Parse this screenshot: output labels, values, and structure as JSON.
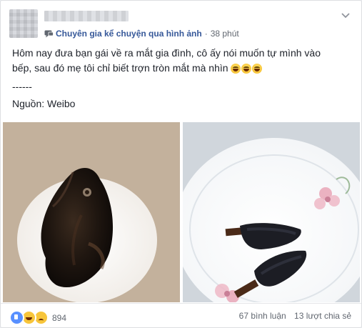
{
  "post": {
    "group": {
      "icon": "group-icon",
      "name": "Chuyên gia kể chuyện qua hình ảnh",
      "separator": "·",
      "time": "38 phút"
    },
    "options_icon": "chevron-down-icon",
    "text": {
      "line1": "Hôm nay đưa bạn gái về ra mắt gia đình, cô ấy nói muốn tự mình vào",
      "line2": "bếp, sau đó mẹ tôi chỉ biết trợn tròn mắt mà nhìn",
      "emojis": [
        "laughing-emoji",
        "laughing-emoji",
        "laughing-emoji"
      ],
      "separator": "------",
      "source": "Nguồn: Weibo"
    },
    "photos": [
      {
        "name": "photo-burnt-fish",
        "description_icon": "plate-image"
      },
      {
        "name": "photo-burnt-pastries",
        "description_icon": "plate-image"
      }
    ],
    "footer": {
      "reactions": [
        "like-icon",
        "haha-icon",
        "sad-icon"
      ],
      "reaction_count": "894",
      "comments": "67 bình luận",
      "shares": "13 lượt chia sẻ"
    }
  },
  "colors": {
    "link_blue": "#365899",
    "meta_gray": "#616770",
    "like_blue": "#5890ff",
    "emoji_yellow": "#f7c53a"
  }
}
